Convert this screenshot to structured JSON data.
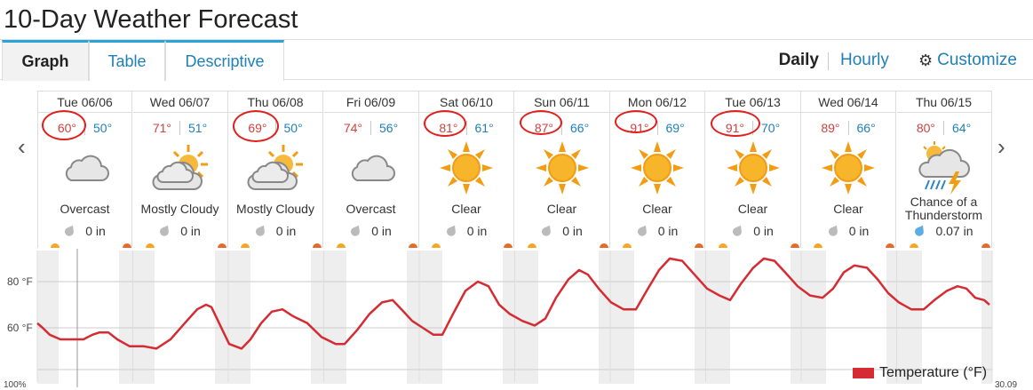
{
  "title": "10-Day Weather Forecast",
  "tabs": [
    {
      "label": "Graph",
      "active": true
    },
    {
      "label": "Table",
      "active": false
    },
    {
      "label": "Descriptive",
      "active": false
    }
  ],
  "view": {
    "daily": "Daily",
    "hourly": "Hourly",
    "customize": "Customize"
  },
  "days": [
    {
      "date": "Tue 06/06",
      "hi": "60°",
      "lo": "50°",
      "icon": "cloud-icon",
      "cond": "Overcast",
      "precip": "0 in"
    },
    {
      "date": "Wed 06/07",
      "hi": "71°",
      "lo": "51°",
      "icon": "partly-cloudy-icon",
      "cond": "Mostly Cloudy",
      "precip": "0 in"
    },
    {
      "date": "Thu 06/08",
      "hi": "69°",
      "lo": "50°",
      "icon": "partly-cloudy-icon",
      "cond": "Mostly Cloudy",
      "precip": "0 in"
    },
    {
      "date": "Fri 06/09",
      "hi": "74°",
      "lo": "56°",
      "icon": "cloud-icon",
      "cond": "Overcast",
      "precip": "0 in"
    },
    {
      "date": "Sat 06/10",
      "hi": "81°",
      "lo": "61°",
      "icon": "sun-icon",
      "cond": "Clear",
      "precip": "0 in"
    },
    {
      "date": "Sun 06/11",
      "hi": "87°",
      "lo": "66°",
      "icon": "sun-icon",
      "cond": "Clear",
      "precip": "0 in"
    },
    {
      "date": "Mon 06/12",
      "hi": "91°",
      "lo": "69°",
      "icon": "sun-icon",
      "cond": "Clear",
      "precip": "0 in"
    },
    {
      "date": "Tue 06/13",
      "hi": "91°",
      "lo": "70°",
      "icon": "sun-icon",
      "cond": "Clear",
      "precip": "0 in"
    },
    {
      "date": "Wed 06/14",
      "hi": "89°",
      "lo": "66°",
      "icon": "sun-icon",
      "cond": "Clear",
      "precip": "0 in"
    },
    {
      "date": "Thu 06/15",
      "hi": "80°",
      "lo": "64°",
      "icon": "thunderstorm-icon",
      "cond": "Chance of a Thunderstorm",
      "precip": "0.07 in"
    }
  ],
  "graph": {
    "y_ticks": [
      "80 °F",
      "60 °F"
    ],
    "legend": "Temperature (°F)",
    "left_axis_label": "100%",
    "right_axis_label": "30.09"
  },
  "colors": {
    "high": "#d0413e",
    "low": "#1f7fb8",
    "line": "#d52b32",
    "accent": "#2aa3d6",
    "annotation": "#e0201d"
  }
}
